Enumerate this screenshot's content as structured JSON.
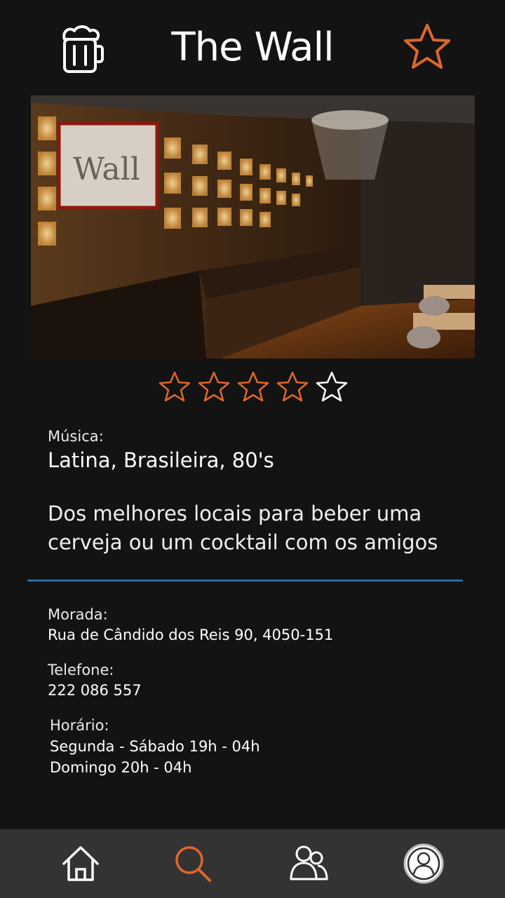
{
  "header": {
    "title": "The Wall",
    "logo_icon": "beer-mug-icon",
    "favorite_icon": "star-outline-icon"
  },
  "photo": {
    "description_icon": "bar-interior-photo"
  },
  "rating": {
    "value": 4,
    "max": 5,
    "filled_color": "#e0662c",
    "empty_color": "#ffffff"
  },
  "music": {
    "label": "Música:",
    "value": "Latina, Brasileira, 80's"
  },
  "description": {
    "line1": "Dos melhores locais para beber uma",
    "line2": "cerveja ou um cocktail com os amigos"
  },
  "address": {
    "label": "Morada:",
    "value": "Rua de Cândido dos Reis 90, 4050-151"
  },
  "phone": {
    "label": "Telefone:",
    "value": "222 086 557"
  },
  "hours": {
    "label": "Horário:",
    "line1": "Segunda - Sábado 19h - 04h",
    "line2": "Domingo  20h - 04h"
  },
  "nav": {
    "items": [
      {
        "icon": "home-icon",
        "active": false
      },
      {
        "icon": "search-icon",
        "active": true
      },
      {
        "icon": "friends-icon",
        "active": false
      },
      {
        "icon": "profile-icon",
        "active": false
      }
    ]
  },
  "colors": {
    "accent": "#e0662c",
    "divider": "#1f6fa8",
    "background": "#131313",
    "navbar": "#333333"
  }
}
